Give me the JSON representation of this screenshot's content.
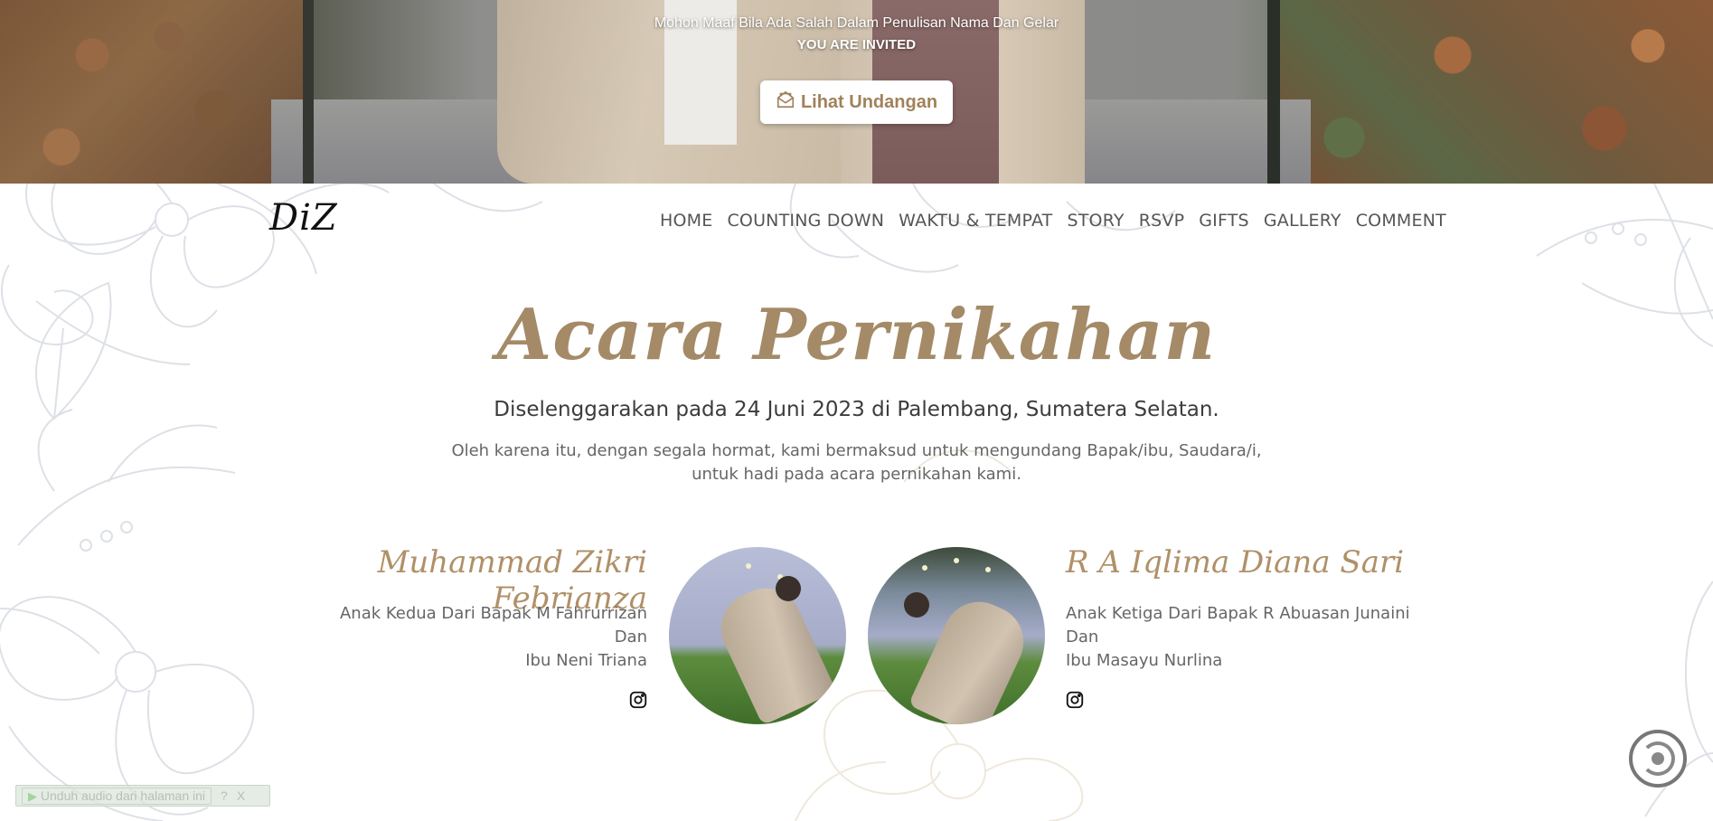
{
  "hero": {
    "notice": "Mohon Maaf Bila Ada Salah Dalam Penulisan Nama Dan Gelar",
    "invited": "YOU ARE INVITED",
    "button_label": "Lihat Undangan",
    "button_icon": "envelope-open-icon"
  },
  "nav": {
    "logo": "DiZ",
    "items": [
      "HOME",
      "COUNTING DOWN",
      "WAKTU & TEMPAT",
      "STORY",
      "RSVP",
      "GIFTS",
      "GALLERY",
      "COMMENT"
    ]
  },
  "event": {
    "title": "Acara Pernikahan",
    "subtitle": "Diselenggarakan pada 24 Juni 2023 di Palembang, Sumatera Selatan.",
    "intro_line1": "Oleh karena itu, dengan segala hormat, kami bermaksud untuk mengundang Bapak/ibu, Saudara/i,",
    "intro_line2": "untuk hadi pada acara pernikahan kami."
  },
  "groom": {
    "name": "Muhammad Zikri Febrianza",
    "parents_line1": "Anak Kedua Dari Bapak M Fahrurrizan",
    "parents_line2": "Dan",
    "parents_line3": "Ibu Neni Triana",
    "social_icon": "instagram-icon"
  },
  "bride": {
    "name": "R A Iqlima Diana Sari",
    "parents_line1": "Anak Ketiga Dari Bapak R Abuasan Junaini",
    "parents_line2": "Dan",
    "parents_line3": "Ibu Masayu Nurlina",
    "social_icon": "instagram-icon"
  },
  "audio_bar": {
    "link_text": "Unduh audio dari halaman ini",
    "help": "?",
    "close": "X"
  },
  "colors": {
    "accent": "#a48a67",
    "name_color": "#b09068",
    "nav_text": "#555555",
    "floral_line": "#d9dce3"
  }
}
